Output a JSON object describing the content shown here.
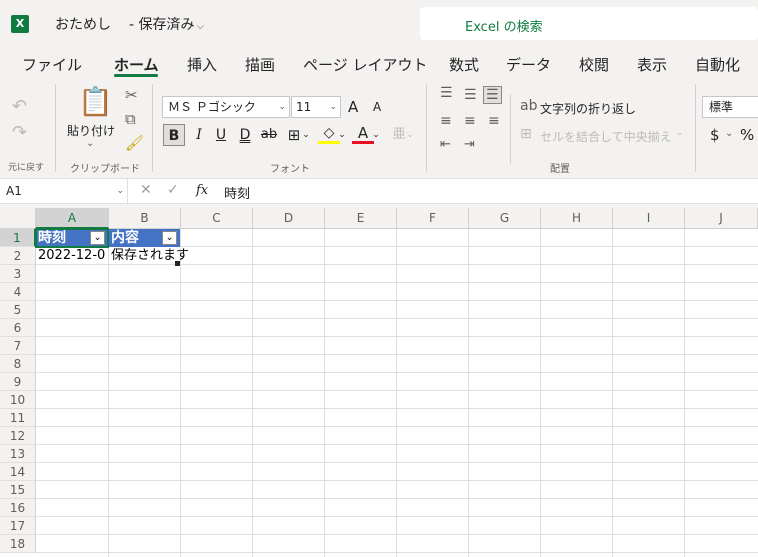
{
  "title_bar": {
    "app_icon": "excel-logo",
    "app_letter": "X",
    "doc_name": "おためし",
    "doc_status": "- 保存済み",
    "status_chevron": "⌵",
    "search_label": "Excel の検索"
  },
  "tabs": [
    "ファイル",
    "ホーム",
    "挿入",
    "描画",
    "ページ レイアウト",
    "数式",
    "データ",
    "校閲",
    "表示",
    "自動化"
  ],
  "active_tab": "ホーム",
  "ribbon": {
    "undo_group_label": "元に戻す",
    "clipboard": {
      "paste_label": "貼り付け",
      "paste_chevron": "⌄",
      "group_label": "クリップボード"
    },
    "font": {
      "font_name": "ＭＳ Ｐゴシック",
      "font_size": "11",
      "increase_label": "A",
      "decrease_label": "A",
      "bold": "B",
      "italic": "I",
      "underline": "U",
      "double_underline": "D",
      "strikethrough": "ab",
      "font_color_letter": "A",
      "fill_color": "#ffff00",
      "font_color": "#e81123",
      "group_label": "フォント"
    },
    "alignment": {
      "wrap_label": "文字列の折り返し",
      "merge_label": "セルを結合して中央揃え",
      "group_label": "配置"
    },
    "number": {
      "format": "標準",
      "currency": "$",
      "percent": "%"
    }
  },
  "formula_bar": {
    "name_box": "A1",
    "fx": "fx",
    "content": "時刻"
  },
  "grid": {
    "columns": [
      "A",
      "B",
      "C",
      "D",
      "E",
      "F",
      "G",
      "H",
      "I",
      "J"
    ],
    "rows": [
      "1",
      "2",
      "3",
      "4",
      "5",
      "6",
      "7",
      "8",
      "9",
      "10",
      "11",
      "12",
      "13",
      "14",
      "15",
      "16",
      "17",
      "18"
    ],
    "selected_column": "A",
    "selected_row": "1",
    "table_header_color": "#4472c4",
    "table_headers": [
      "時刻",
      "内容"
    ],
    "cells": {
      "A2": "2022-12-0",
      "B2": "保存されます"
    }
  },
  "accent_color": "#107c41"
}
